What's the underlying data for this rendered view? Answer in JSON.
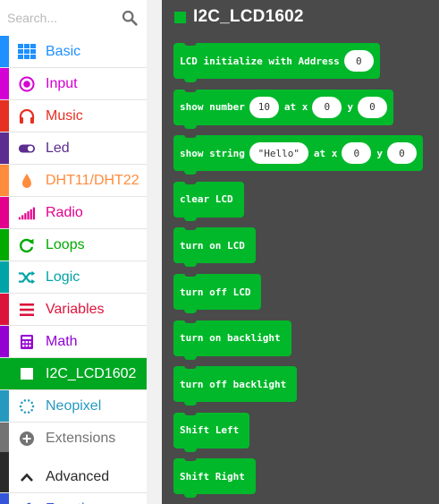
{
  "search": {
    "placeholder": "Search..."
  },
  "categories": [
    {
      "id": "basic",
      "label": "Basic",
      "color": "#1e90ff",
      "icon": "grid-icon"
    },
    {
      "id": "input",
      "label": "Input",
      "color": "#d400d4",
      "icon": "input-circle-icon"
    },
    {
      "id": "music",
      "label": "Music",
      "color": "#e63022",
      "icon": "headphones-icon"
    },
    {
      "id": "led",
      "label": "Led",
      "color": "#5c2d91",
      "icon": "toggle-icon"
    },
    {
      "id": "dht",
      "label": "DHT11/DHT22",
      "color": "#ff8c3c",
      "icon": "drop-icon"
    },
    {
      "id": "radio",
      "label": "Radio",
      "color": "#e3008c",
      "icon": "signal-bars-icon"
    },
    {
      "id": "loops",
      "label": "Loops",
      "color": "#00aa00",
      "icon": "loop-arrow-icon"
    },
    {
      "id": "logic",
      "label": "Logic",
      "color": "#00a4a6",
      "icon": "shuffle-icon"
    },
    {
      "id": "variables",
      "label": "Variables",
      "color": "#dc143c",
      "icon": "lines-icon"
    },
    {
      "id": "math",
      "label": "Math",
      "color": "#9400d3",
      "icon": "calculator-icon"
    },
    {
      "id": "i2c",
      "label": "I2C_LCD1602",
      "color": "#00a822",
      "icon": "lcd-square-icon"
    },
    {
      "id": "neopixel",
      "label": "Neopixel",
      "color": "#2699bf",
      "icon": "dotted-circle-icon"
    },
    {
      "id": "extensions",
      "label": "Extensions",
      "color": "#737373",
      "icon": "plus-circle-icon"
    },
    {
      "id": "advanced",
      "label": "Advanced",
      "color": "#2a2a2a",
      "icon": "chevron-up-icon"
    },
    {
      "id": "functions",
      "label": "Functions",
      "color": "#3455db",
      "icon": "function-icon"
    }
  ],
  "flyout": {
    "title": "I2C_LCD1602",
    "accent": "#00b82a",
    "blocks": [
      {
        "parts": [
          {
            "kind": "text",
            "value": "LCD initialize with Address"
          },
          {
            "kind": "pill",
            "value": "0"
          }
        ]
      },
      {
        "parts": [
          {
            "kind": "text",
            "value": "show number"
          },
          {
            "kind": "pill",
            "value": "10"
          },
          {
            "kind": "text",
            "value": "at x"
          },
          {
            "kind": "pill",
            "value": "0"
          },
          {
            "kind": "text",
            "value": "y"
          },
          {
            "kind": "pill",
            "value": "0"
          }
        ]
      },
      {
        "parts": [
          {
            "kind": "text",
            "value": "show string"
          },
          {
            "kind": "pill-str",
            "value": "\"Hello\""
          },
          {
            "kind": "text",
            "value": "at x"
          },
          {
            "kind": "pill",
            "value": "0"
          },
          {
            "kind": "text",
            "value": "y"
          },
          {
            "kind": "pill",
            "value": "0"
          }
        ]
      },
      {
        "parts": [
          {
            "kind": "text",
            "value": "clear LCD"
          }
        ]
      },
      {
        "parts": [
          {
            "kind": "text",
            "value": "turn on LCD"
          }
        ]
      },
      {
        "parts": [
          {
            "kind": "text",
            "value": "turn off LCD"
          }
        ]
      },
      {
        "parts": [
          {
            "kind": "text",
            "value": "turn on backlight"
          }
        ]
      },
      {
        "parts": [
          {
            "kind": "text",
            "value": "turn off backlight"
          }
        ]
      },
      {
        "parts": [
          {
            "kind": "text",
            "value": "Shift Left"
          }
        ]
      },
      {
        "parts": [
          {
            "kind": "text",
            "value": "Shift Right"
          }
        ]
      }
    ]
  }
}
